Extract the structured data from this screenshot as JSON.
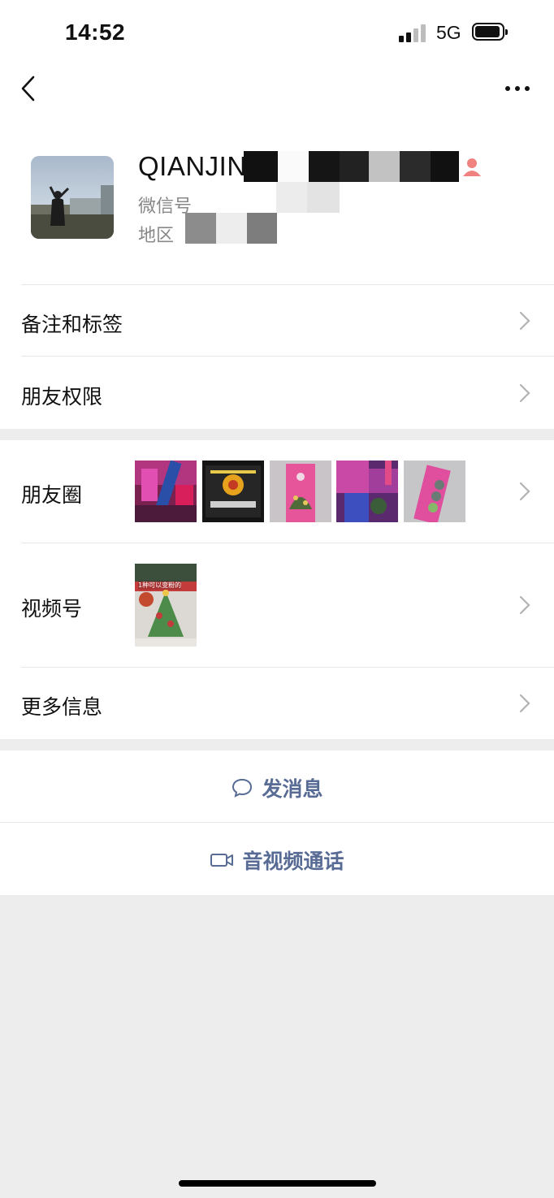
{
  "status_bar": {
    "time": "14:52",
    "network": "5G",
    "icons": [
      "signal-icon",
      "battery-icon"
    ]
  },
  "nav": {
    "icons": [
      "back-arrow-icon",
      "more-dots-icon"
    ]
  },
  "profile": {
    "name": "QIANJIN",
    "wechat_id_label": "微信号",
    "region_label": "地区",
    "badge_icon": "person-icon",
    "badge_color": "#f0837f"
  },
  "rows": {
    "remark": "备注和标签",
    "permissions": "朋友权限",
    "moments": "朋友圈",
    "channels": "视频号",
    "more_info": "更多信息"
  },
  "channels_thumb_caption": "1种可以变粉的",
  "actions": {
    "message": "发消息",
    "call": "音视频通话",
    "message_icon": "chat-bubble-icon",
    "call_icon": "video-camera-icon"
  },
  "colors": {
    "link": "#576b95",
    "background": "#ededed",
    "surface": "#ffffff"
  }
}
